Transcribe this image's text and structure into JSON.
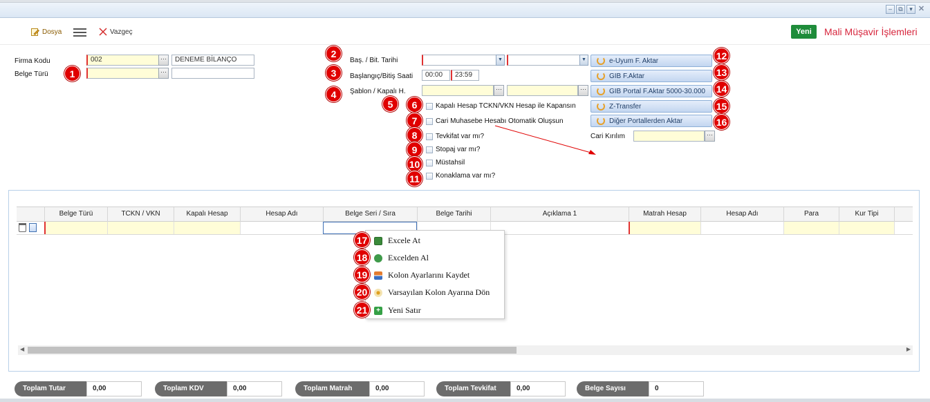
{
  "toolbar": {
    "file_label": "Dosya",
    "cancel_label": "Vazgeç",
    "new_label": "Yeni",
    "page_title": "Mali Müşavir İşlemleri"
  },
  "form": {
    "firma_kodu_label": "Firma Kodu",
    "firma_kodu_value": "002",
    "firma_adi_value": "DENEME BİLANÇO",
    "belge_turu_label": "Belge Türü",
    "bas_bit_tarihi_label": "Baş. / Bit. Tarihi",
    "saat_label": "Başlangıç/Bitiş Saati",
    "saat_baslangic": "00:00",
    "saat_bitis": "23:59",
    "sablon_label": "Şablon / Kapalı H.",
    "dots": "···",
    "cari_kirilim_label": "Cari Kırılım"
  },
  "checkboxes": [
    "Kapalı Hesap TCKN/VKN Hesap ile Kapansın",
    "Cari Muhasebe Hesabı Otomatik Oluşsun",
    "Tevkifat var mı?",
    "Stopaj var mı?",
    "Müstahsil",
    "Konaklama var mı?"
  ],
  "actions": [
    "e-Uyum F. Aktar",
    "GIB F.Aktar",
    "GIB Portal F.Aktar 5000-30.000",
    "Z-Transfer",
    "Diğer Portallerden Aktar"
  ],
  "badges": [
    "1",
    "2",
    "3",
    "4",
    "5",
    "6",
    "7",
    "8",
    "9",
    "10",
    "11",
    "12",
    "13",
    "14",
    "15",
    "16",
    "17",
    "18",
    "19",
    "20",
    "21"
  ],
  "grid": {
    "columns": [
      "Belge Türü",
      "TCKN / VKN",
      "Kapalı Hesap",
      "Hesap Adı",
      "Belge Seri / Sıra",
      "Belge Tarihi",
      "Açıklama 1",
      "Matrah Hesap",
      "Hesap Adı",
      "Para",
      "Kur Tipi"
    ]
  },
  "context_menu": [
    "Excele At",
    "Excelden Al",
    "Kolon Ayarlarını Kaydet",
    "Varsayılan Kolon Ayarına Dön",
    "Yeni Satır"
  ],
  "totals": [
    {
      "label": "Toplam Tutar",
      "value": "0,00"
    },
    {
      "label": "Toplam KDV",
      "value": "0,00"
    },
    {
      "label": "Toplam Matrah",
      "value": "0,00"
    },
    {
      "label": "Toplam Tevkifat",
      "value": "0,00"
    },
    {
      "label": "Belge Sayısı",
      "value": "0"
    }
  ],
  "colors": {
    "accent_red": "#d7263d",
    "badge_red": "#e00000",
    "new_green": "#1e8c3a"
  }
}
